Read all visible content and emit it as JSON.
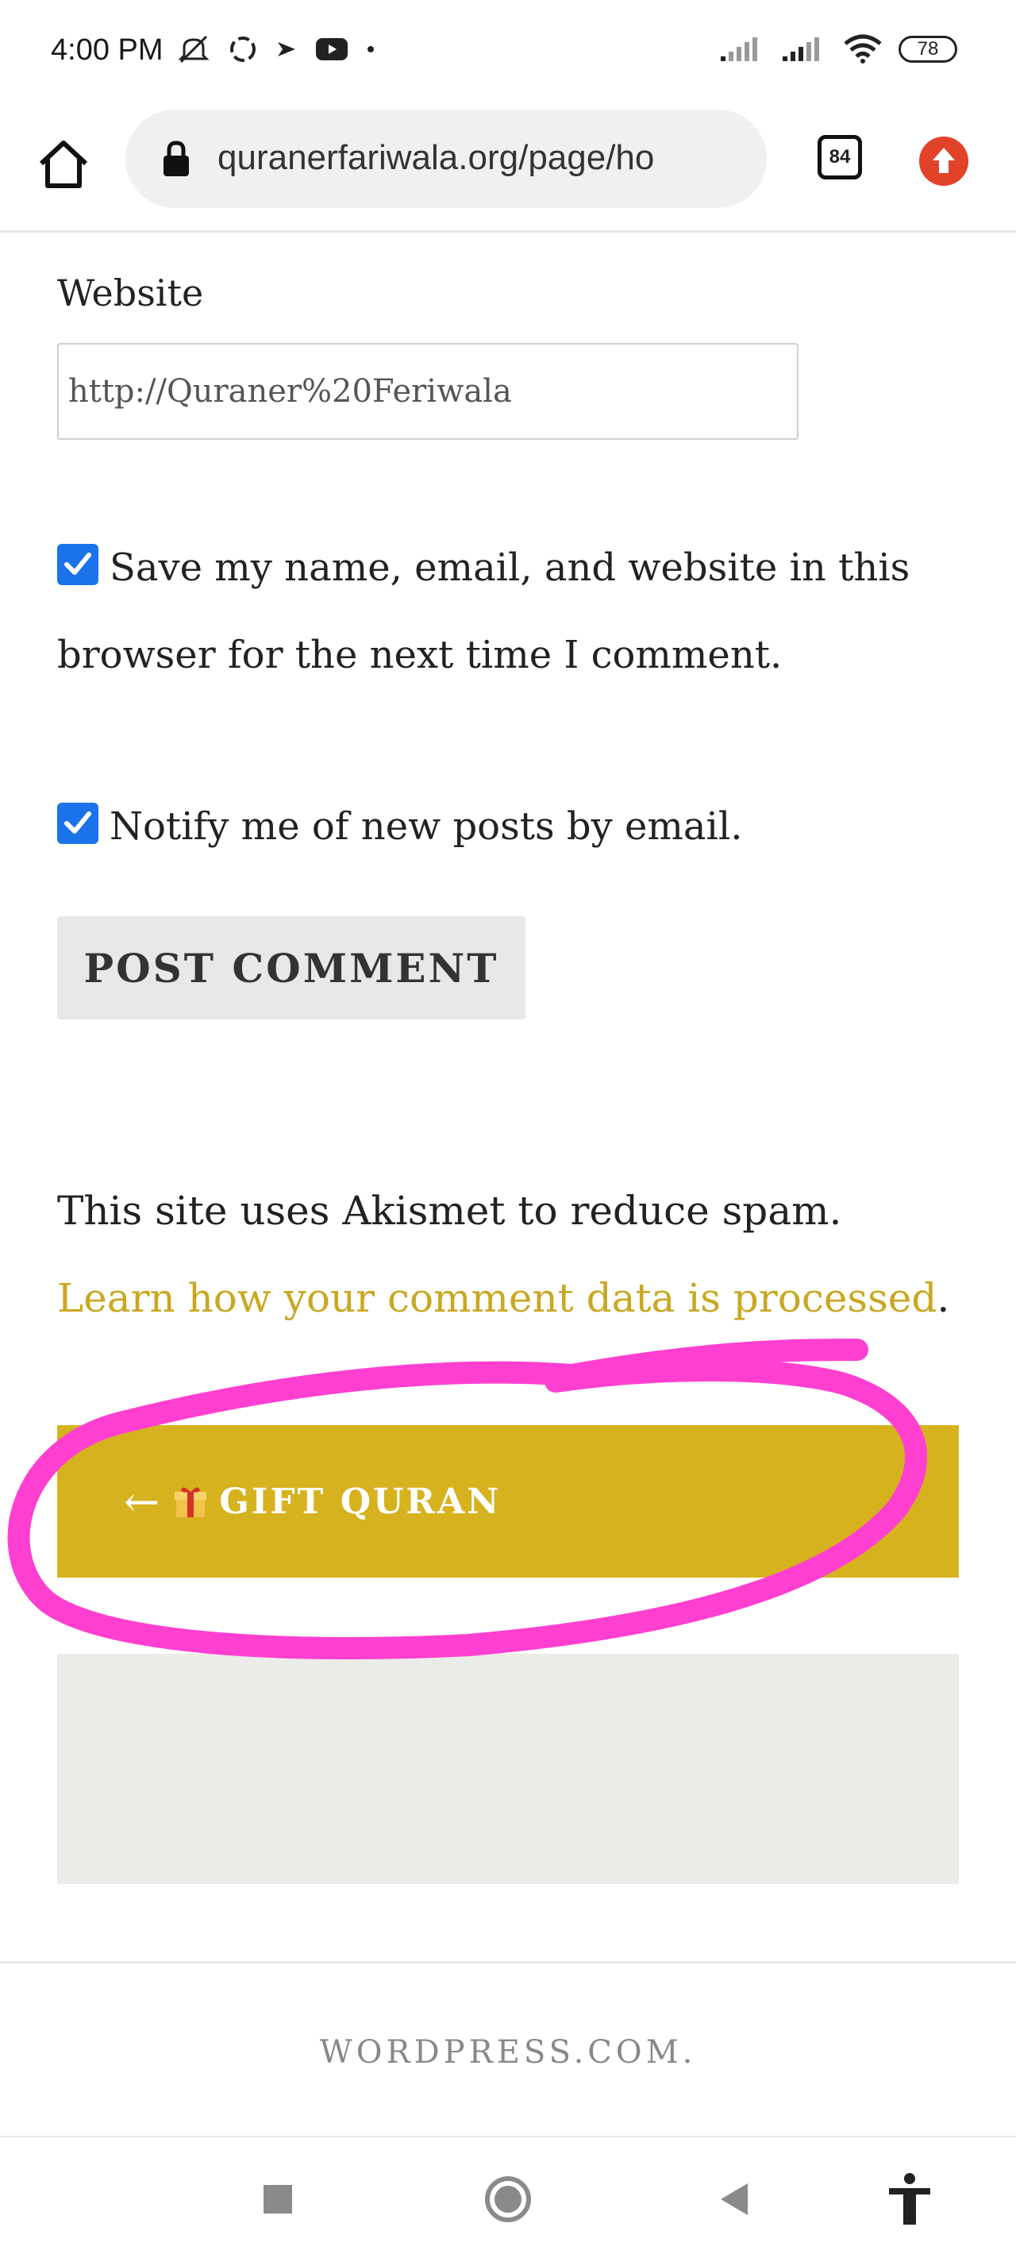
{
  "status_bar": {
    "time": "4:00 PM",
    "battery": "78",
    "icons": [
      "mute-icon",
      "sync-icon",
      "arrow-icon",
      "youtube-icon",
      "dot-icon",
      "signal-icon",
      "signal-icon",
      "wifi-icon",
      "battery-icon"
    ]
  },
  "browser": {
    "url": "quranerfariwala.org/page/ho",
    "tab_count": "84"
  },
  "form": {
    "website_label": "Website",
    "website_value": "http://Quraner%20Feriwala",
    "save_info_label": "Save my name, email, and website in this browser for the next time I comment.",
    "save_info_checked": true,
    "notify_label": "Notify me of new posts by email.",
    "notify_checked": true,
    "submit_label": "POST COMMENT"
  },
  "akismet": {
    "text": "This site uses Akismet to reduce spam.",
    "link_text": "Learn how your comment data is processed",
    "suffix": "."
  },
  "post_nav": {
    "arrow": "←",
    "label": "GIFT QURAN"
  },
  "footer": {
    "text": "WORDPRESS.COM."
  },
  "colors": {
    "accent": "#d6b21f",
    "link": "#c9a722",
    "checkbox": "#1a73e8",
    "annotation": "#ff3fd0"
  }
}
